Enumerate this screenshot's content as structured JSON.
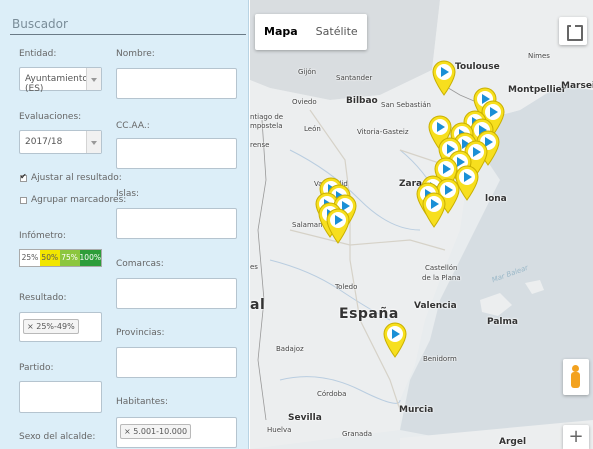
{
  "sidebar": {
    "title": "Buscador",
    "entidad": {
      "label": "Entidad:",
      "value": "Ayuntamiento (ES)"
    },
    "evaluaciones": {
      "label": "Evaluaciones:",
      "value": "2017/18"
    },
    "ajustar": {
      "label": "Ajustar al resultado:",
      "checked": true
    },
    "agrupar": {
      "label": "Agrupar marcadores:",
      "checked": false
    },
    "infometro": {
      "label": "Infómetro:",
      "segments": [
        {
          "text": "25%",
          "color": "#ffffff"
        },
        {
          "text": "50%",
          "color": "#f2e600"
        },
        {
          "text": "75%",
          "color": "#8cc63e"
        },
        {
          "text": "100%",
          "color": "#2d9d3a"
        }
      ]
    },
    "resultado": {
      "label": "Resultado:",
      "tag": "× 25%-49%"
    },
    "partido": {
      "label": "Partido:"
    },
    "sexo": {
      "label": "Sexo del alcalde:"
    },
    "nombre": {
      "label": "Nombre:"
    },
    "ccaa": {
      "label": "CC.AA.:"
    },
    "islas": {
      "label": "Islas:"
    },
    "comarcas": {
      "label": "Comarcas:"
    },
    "provincias": {
      "label": "Provincias:"
    },
    "habitantes": {
      "label": "Habitantes:",
      "tag": "× 5.001-10.000"
    }
  },
  "map": {
    "type_buttons": {
      "map": "Mapa",
      "satellite": "Satélite"
    },
    "labels": {
      "toulouse": "Toulouse",
      "nimes": "Nimes",
      "montpellier": "Montpellier",
      "marseille": "Marseille",
      "gijon": "Gijón",
      "santander": "Santander",
      "bilbao": "Bilbao",
      "san_sebastian": "San Sebastián",
      "oviedo": "Oviedo",
      "santiago": "ntiago de",
      "compostela": "mpostela",
      "leon": "León",
      "vitoria": "Vitoria-Gasteiz",
      "orense": "rense",
      "valladolid": "Valladolid",
      "zaragoza": "Zaragoza",
      "salamanca": "Salamanca",
      "bcn": "lona",
      "castellon": "Castellón",
      "de_la_plana": "de la Plana",
      "toledo": "Toledo",
      "espana": "España",
      "valencia": "Valencia",
      "palma": "Palma",
      "mar_balear": "Mar Balear",
      "badajoz": "Badajoz",
      "benidorm": "Benidorm",
      "cordoba": "Córdoba",
      "murcia": "Murcia",
      "sevilla": "Sevilla",
      "huelva": "Huelva",
      "granada": "Granada",
      "argel": "Argel",
      "portugal_fragment": "al",
      "es_fragment": "es"
    },
    "marker_color": "#f7df1e",
    "marker_icon_color": "#1a8fd6"
  }
}
